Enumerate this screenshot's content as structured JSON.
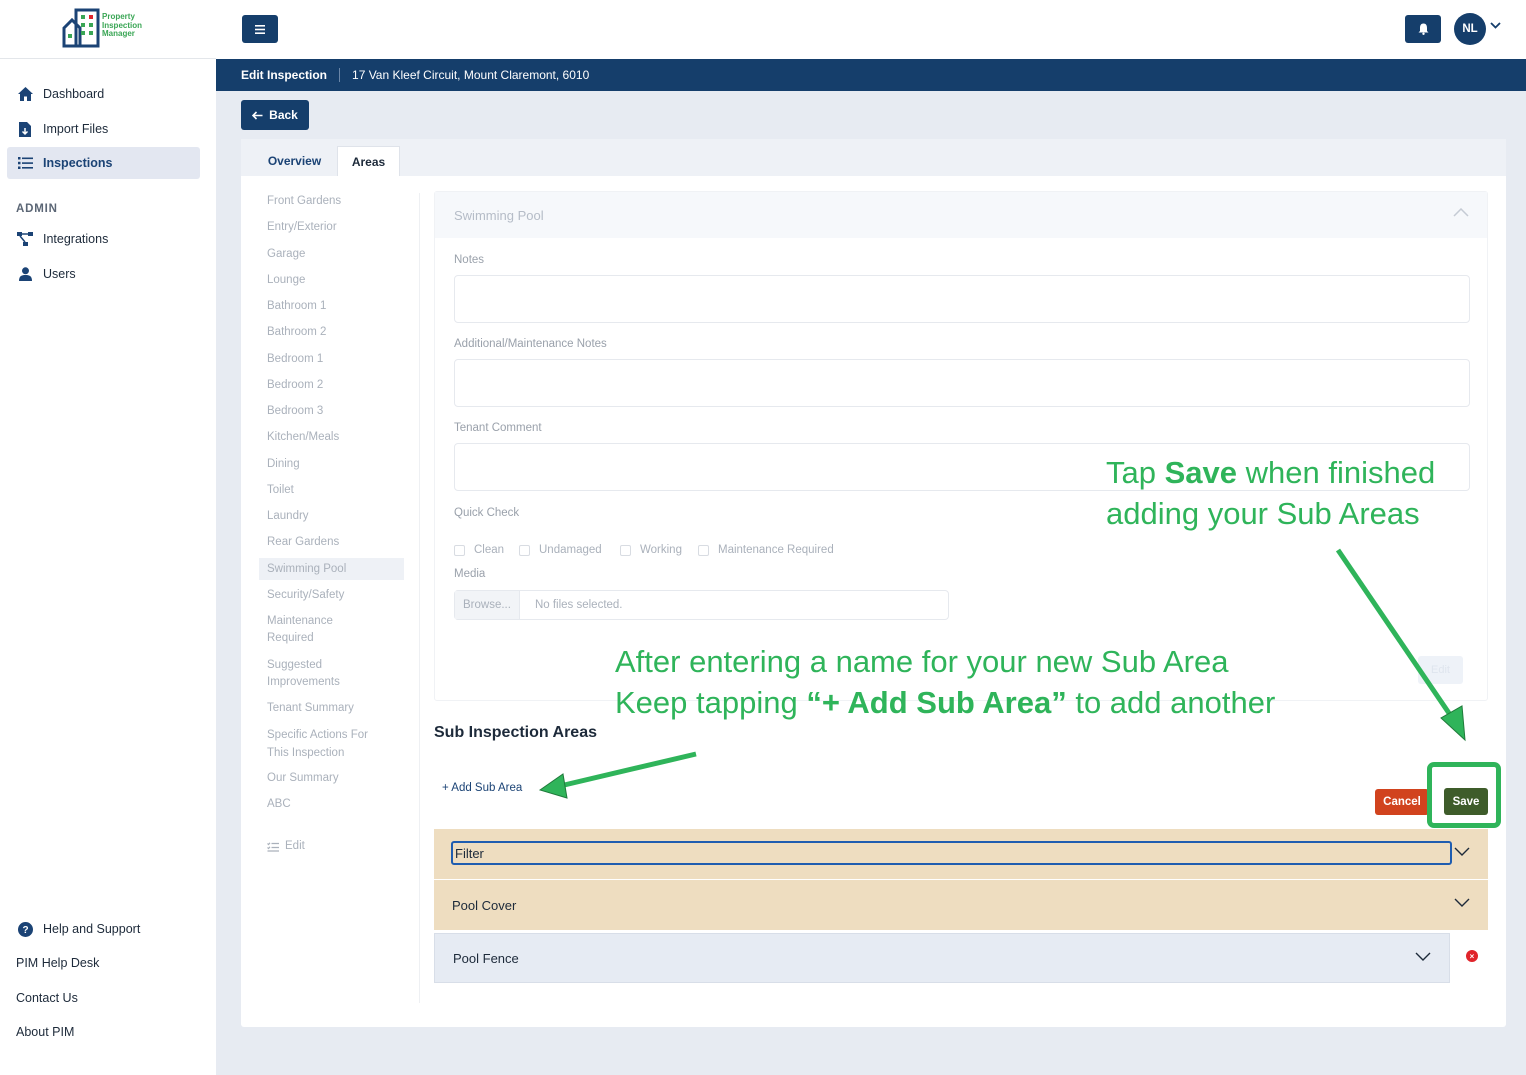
{
  "logo": {
    "text": "Property\nInspection\nManager"
  },
  "nav": {
    "items": [
      {
        "label": "Dashboard",
        "icon": "home-icon"
      },
      {
        "label": "Import Files",
        "icon": "file-import-icon"
      },
      {
        "label": "Inspections",
        "icon": "list-icon",
        "active": true
      }
    ],
    "admin_label": "ADMIN",
    "admin_items": [
      {
        "label": "Integrations",
        "icon": "network-icon"
      },
      {
        "label": "Users",
        "icon": "user-icon"
      }
    ],
    "footer": {
      "help": "Help and Support",
      "helpdesk": "PIM Help Desk",
      "contact": "Contact Us",
      "about": "About PIM"
    }
  },
  "topbar": {
    "avatar_initials": "NL"
  },
  "subheader": {
    "title": "Edit Inspection",
    "address": "17 Van Kleef Circuit, Mount Claremont, 6010"
  },
  "back_label": "Back",
  "tabs": [
    {
      "label": "Overview"
    },
    {
      "label": "Areas",
      "active": true
    }
  ],
  "areas": [
    "Front Gardens",
    "Entry/Exterior",
    "Garage",
    "Lounge",
    "Bathroom 1",
    "Bathroom 2",
    "Bedroom 1",
    "Bedroom 2",
    "Bedroom 3",
    "Kitchen/Meals",
    "Dining",
    "Toilet",
    "Laundry",
    "Rear Gardens",
    "Swimming Pool",
    "Security/Safety",
    "Maintenance Required",
    "Suggested Improvements",
    "Tenant Summary",
    "Specific Actions For This Inspection",
    "Our Summary",
    "ABC"
  ],
  "areas_edit_label": "Edit",
  "panel": {
    "title": "Swimming Pool",
    "notes_label": "Notes",
    "maintenance_label": "Additional/Maintenance Notes",
    "tenant_label": "Tenant Comment",
    "quick_check_label": "Quick Check",
    "quick_checks": [
      "Clean",
      "Undamaged",
      "Working",
      "Maintenance Required"
    ],
    "media_label": "Media",
    "browse_label": "Browse...",
    "no_files": "No files selected.",
    "edit_label": "Edit"
  },
  "sub_areas": {
    "title": "Sub Inspection Areas",
    "add_label": "+ Add Sub Area",
    "cancel_label": "Cancel",
    "save_label": "Save",
    "items": [
      {
        "name": "Filter",
        "editing": true
      },
      {
        "name": "Pool Cover"
      },
      {
        "name": "Pool Fence"
      }
    ]
  },
  "annotations": {
    "save_tip_1": "Tap ",
    "save_tip_bold": "Save",
    "save_tip_2": " when finished",
    "save_tip_line2": "adding your Sub Areas",
    "add_tip_line1": "After entering a name for your new Sub Area",
    "add_tip_2a": "Keep tapping ",
    "add_tip_bold": "“+ Add Sub Area”",
    "add_tip_2b": " to add another"
  },
  "colors": {
    "primary": "#153e6b",
    "accent_green": "#2fb45a",
    "sub_row_bg": "#eeddc0",
    "cancel": "#d1431e",
    "save": "#3e5c2a"
  }
}
